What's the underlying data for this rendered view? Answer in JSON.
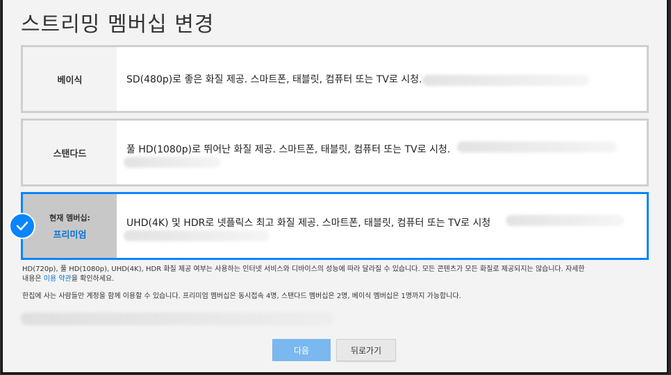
{
  "title": "스트리밍 멤버십 변경",
  "plans": [
    {
      "name": "베이식",
      "description": "SD(480p)로 좋은 화질 제공. 스마트폰, 태블릿, 컴퓨터 또는 TV로 시청."
    },
    {
      "name": "스탠다드",
      "description": "풀 HD(1080p)로 뛰어난 화질 제공. 스마트폰, 태블릿, 컴퓨터 또는 TV로 시청."
    },
    {
      "current_label": "현재 멤버십:",
      "name": "프리미엄",
      "description": "UHD(4K) 및 HDR로 넷플릭스 최고 화질 제공. 스마트폰, 태블릿, 컴퓨터 또는 TV로 시청"
    }
  ],
  "notes": {
    "quality_text": "HD(720p), 풀 HD(1080p), UHD(4K), HDR 화질 제공 여부는 사용하는 인터넷 서비스와 디바이스의 성능에 따라 달라질 수 있습니다. 모든 콘텐츠가 모든 화질로 제공되지는 않습니다. 자세한",
    "quality_text2_prefix": "내용은 ",
    "terms_link": "이용 약관",
    "quality_text2_suffix": "을 확인하세요.",
    "household_text": "한집에 사는 사람들만 계정을 함께 이용할 수 있습니다. 프리미엄 멤버십은 동시접속 4명, 스탠다드 멤버십은 2명, 베이식 멤버십은 1명까지 가능합니다."
  },
  "buttons": {
    "next": "다음",
    "back": "뒤로가기"
  },
  "colors": {
    "accent": "#0a84ff",
    "link": "#0a72d6",
    "next_button": "#7ab8ef"
  }
}
